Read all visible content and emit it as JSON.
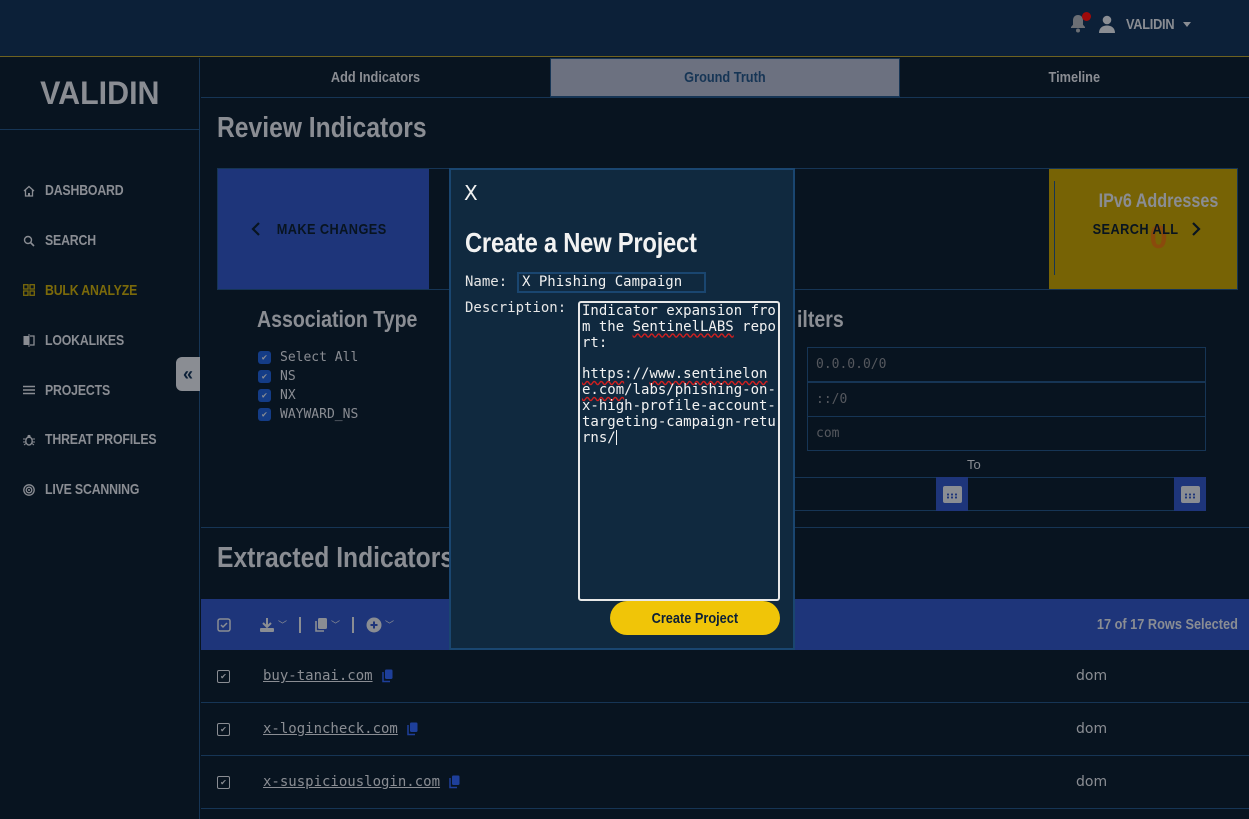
{
  "topbar": {
    "user_label": "VALIDIN",
    "notification_dot_color": "#a00a0a"
  },
  "sidebar": {
    "logo": "VALIDIN",
    "items": [
      {
        "label": "DASHBOARD",
        "icon": "home-icon",
        "active": false
      },
      {
        "label": "SEARCH",
        "icon": "search-icon",
        "active": false
      },
      {
        "label": "BULK ANALYZE",
        "icon": "grid-icon",
        "active": true
      },
      {
        "label": "LOOKALIKES",
        "icon": "lookalike-icon",
        "active": false
      },
      {
        "label": "PROJECTS",
        "icon": "list-icon",
        "active": false
      },
      {
        "label": "THREAT PROFILES",
        "icon": "bug-icon",
        "active": false
      },
      {
        "label": "LIVE SCANNING",
        "icon": "radar-icon",
        "active": false
      }
    ],
    "collapse_glyph": "«"
  },
  "tabs": [
    {
      "label": "Add Indicators",
      "active": false
    },
    {
      "label": "Ground Truth",
      "active": true
    },
    {
      "label": "Timeline",
      "active": false
    }
  ],
  "review": {
    "title": "Review Indicators",
    "make_changes_label": "MAKE CHANGES",
    "ipv6_label": "IPv6 Addresses",
    "ipv6_value": "0",
    "search_all_label": "SEARCH ALL"
  },
  "association": {
    "title": "Association Type",
    "options": [
      {
        "label": "Select All",
        "checked": true
      },
      {
        "label": "NS",
        "checked": true
      },
      {
        "label": "NX",
        "checked": true
      },
      {
        "label": "WAYWARD_NS",
        "checked": true
      }
    ]
  },
  "filters": {
    "title_visible": "ilters",
    "ipv4_placeholder": "0.0.0.0/0",
    "ipv6_placeholder": "::/0",
    "tld_placeholder": "com",
    "to_label": "To"
  },
  "extracted": {
    "title": "Extracted Indicators",
    "rows_selected": "17 of 17 Rows Selected",
    "rows": [
      {
        "domain": "buy-tanai.com",
        "type": "dom"
      },
      {
        "domain": "x-logincheck.com",
        "type": "dom"
      },
      {
        "domain": "x-suspiciouslogin.com",
        "type": "dom"
      }
    ]
  },
  "modal": {
    "close_label": "X",
    "title": "Create a New Project",
    "name_label": "Name:",
    "name_value": "X Phishing Campaign",
    "description_label": "Description:",
    "description_line1": "Indicator expansion from the ",
    "description_misspelled1": "SentinelLABS",
    "description_line2": " report:\n\n",
    "description_url_a": "https",
    "description_url_b": "://",
    "description_url_c": "www.sentinelone.com",
    "description_url_d": "/labs/phishing-on-x-high-profile-account-targeting-campaign-returns/",
    "create_label": "Create Project"
  }
}
